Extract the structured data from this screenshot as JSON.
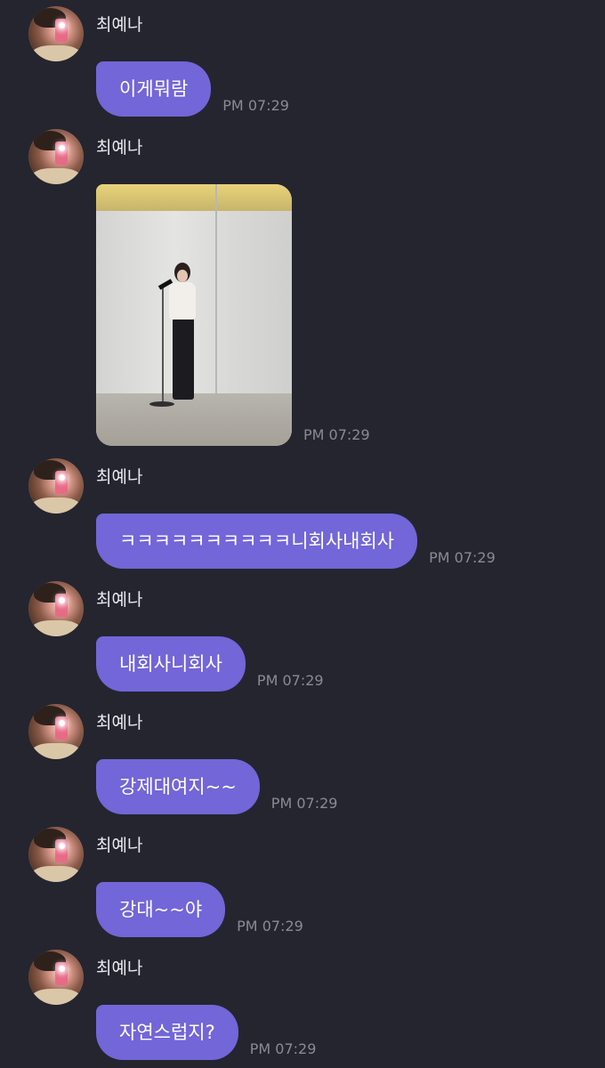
{
  "sender": "최예나",
  "messages": [
    {
      "type": "text",
      "text": "이게뭐람",
      "time": "PM 07:29"
    },
    {
      "type": "image",
      "alt": "",
      "time": "PM 07:29"
    },
    {
      "type": "text",
      "text": "ㅋㅋㅋㅋㅋㅋㅋㅋㅋㅋ니회사내회사",
      "time": "PM 07:29"
    },
    {
      "type": "text",
      "text": "내회사니회사",
      "time": "PM 07:29"
    },
    {
      "type": "text",
      "text": "강제대여지~~",
      "time": "PM 07:29"
    },
    {
      "type": "text",
      "text": "강대~~야",
      "time": "PM 07:29"
    },
    {
      "type": "text",
      "text": "자연스럽지?",
      "time": "PM 07:29"
    }
  ],
  "colors": {
    "background": "#25252f",
    "bubble": "#7266d8",
    "name_text": "#e9e9ee",
    "time_text": "#8a8a96"
  },
  "icons": {
    "avatar": "profile-avatar"
  }
}
